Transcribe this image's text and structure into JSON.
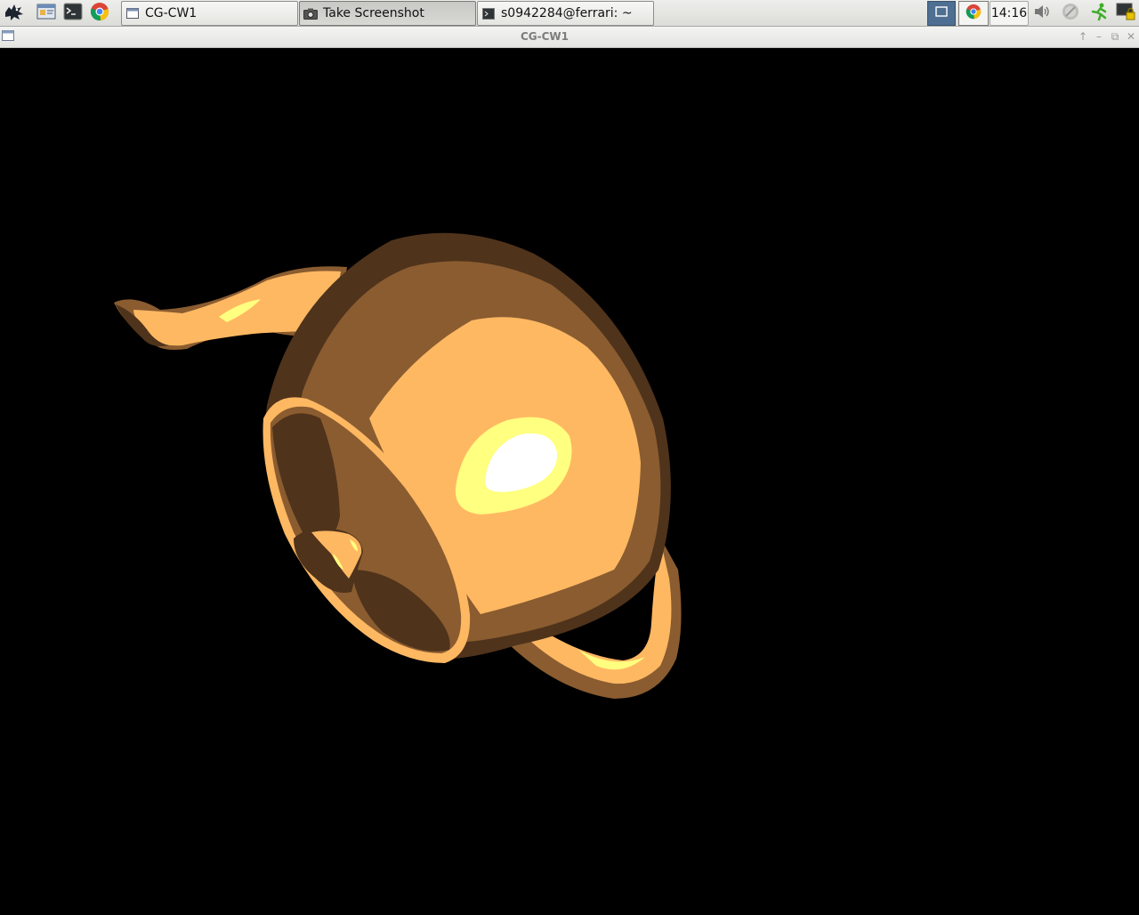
{
  "panel": {
    "launchers": [
      {
        "icon": "xfce-mouse-menu-icon"
      },
      {
        "icon": "file-manager-icon"
      },
      {
        "icon": "terminal-icon"
      },
      {
        "icon": "chrome-icon"
      }
    ],
    "tasks": [
      {
        "label": "CG-CW1",
        "icon": "window-icon",
        "active": false
      },
      {
        "label": "Take Screenshot",
        "icon": "camera-icon",
        "active": true
      },
      {
        "label": "s0942284@ferrari: ~",
        "icon": "terminal-icon",
        "active": false
      }
    ],
    "tray": {
      "workspace_icon": "workspace-switcher-icon",
      "chrome_icon": "chrome-icon",
      "clock": "14:16",
      "volume_icon": "volume-icon",
      "network_icon": "network-icon",
      "run_icon": "running-man-icon",
      "lock_icon": "lock-screen-icon"
    }
  },
  "window": {
    "title": "CG-CW1",
    "controls": [
      "up-arrow-icon",
      "minimize-icon",
      "maximize-icon",
      "close-icon"
    ]
  },
  "scene": {
    "object": "teapot",
    "background_color": "#000000",
    "shades": {
      "dark": "#4f331b",
      "mid": "#8a5c30",
      "light": "#ffb862",
      "highlight": "#ffff80",
      "specular": "#ffffff"
    }
  }
}
